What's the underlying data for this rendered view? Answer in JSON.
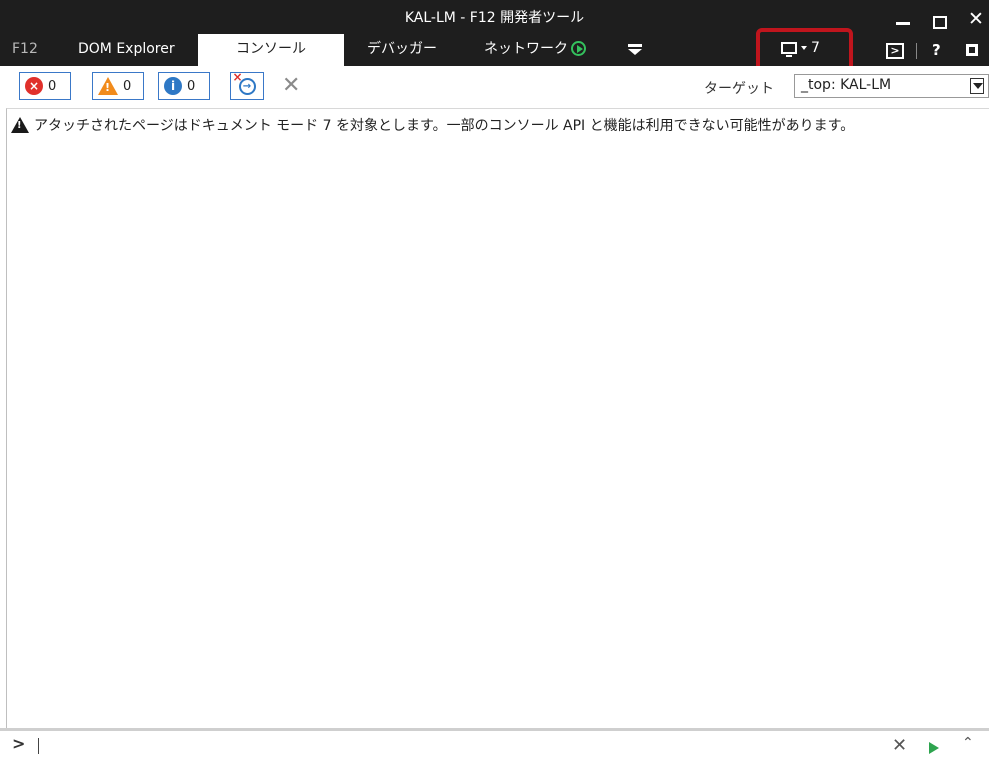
{
  "window": {
    "title": "KAL-LM - F12 開発者ツール",
    "minimize_icon": "minimize-icon",
    "maximize_icon": "maximize-icon",
    "close_icon": "close-icon"
  },
  "tabs": [
    {
      "label": "F12",
      "icon": null,
      "active": false
    },
    {
      "label": "DOM Explorer",
      "active": false
    },
    {
      "label": "コンソール",
      "active": true
    },
    {
      "label": "デバッガー",
      "active": false
    },
    {
      "label": "ネットワーク",
      "active": false,
      "icon": "play-circle-icon"
    }
  ],
  "toolbar_right": {
    "emulation_value": "7",
    "emulation_icon": "monitor-icon",
    "console_icon": "command-prompt-icon",
    "help_label": "?",
    "dock_icon": "dock-icon"
  },
  "console_toolbar": {
    "errors": "0",
    "warnings": "0",
    "info": "0",
    "target_label": "ターゲット",
    "target_value": "_top: KAL-LM"
  },
  "messages": [
    {
      "type": "warning",
      "text": "アタッチされたページはドキュメント モード 7 を対象とします。一部のコンソール API と機能は利用できない可能性があります。"
    }
  ],
  "input": {
    "prompt": ">"
  },
  "colors": {
    "titlebar": "#1e1e1e",
    "highlight": "#c0151d",
    "error": "#e0302b",
    "warning": "#f18b1c",
    "info": "#2e78c5",
    "run": "#2ea44f"
  }
}
